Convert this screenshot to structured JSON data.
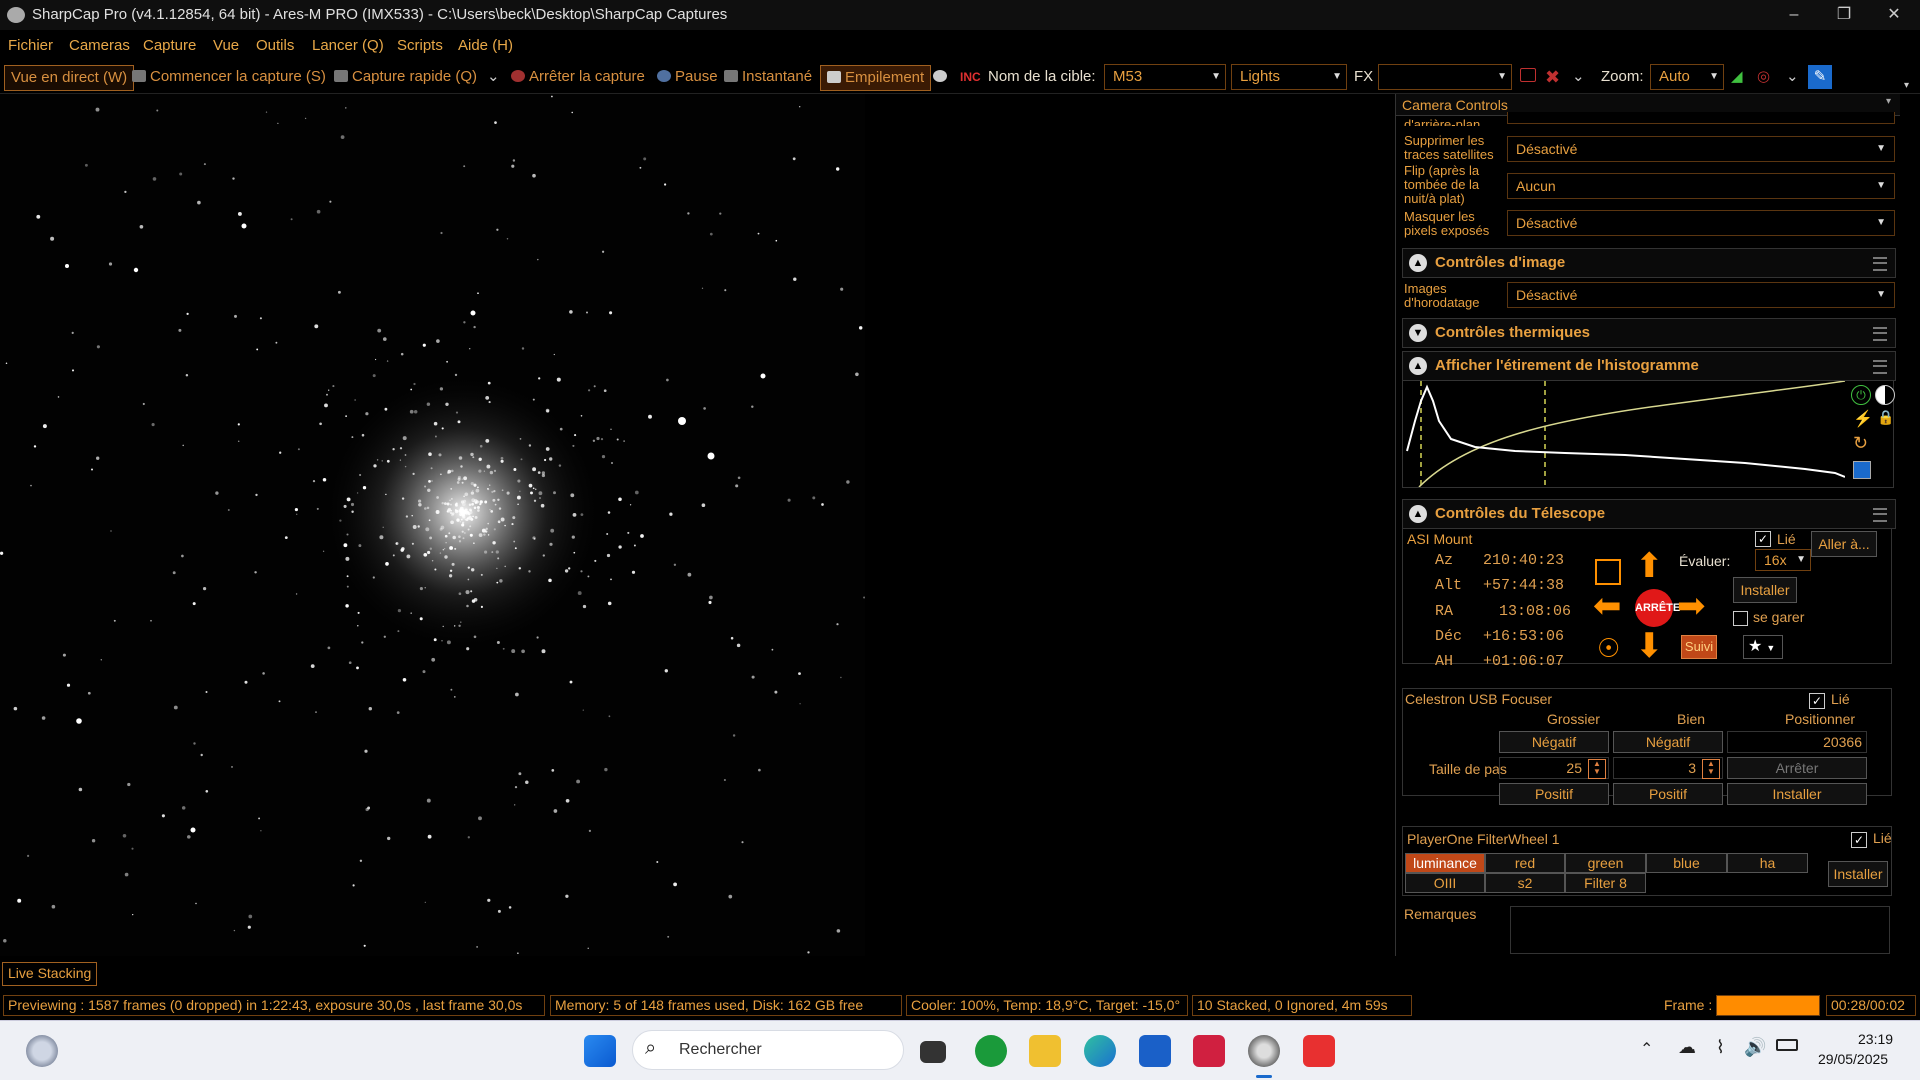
{
  "titlebar": {
    "title": "SharpCap Pro (v4.1.12854, 64 bit) - Ares-M PRO (IMX533) - C:\\Users\\beck\\Desktop\\SharpCap Captures"
  },
  "menu": [
    "Fichier",
    "Cameras",
    "Capture",
    "Vue",
    "Outils",
    "Lancer (Q)",
    "Scripts",
    "Aide (H)"
  ],
  "toolbar": {
    "live": "Vue en direct (W)",
    "start": "Commencer la capture (S)",
    "quick": "Capture rapide (Q)",
    "stop": "Arrêter la capture",
    "pause": "Pause",
    "snapshot": "Instantané",
    "stacking": "Empilement",
    "target_label": "Nom de la cible:",
    "target_value": "M53",
    "frame_type": "Lights",
    "fx_label": "FX",
    "zoom_label": "Zoom:",
    "zoom_value": "Auto"
  },
  "panel": {
    "title": "Camera Controls",
    "partial_label": "d'arrière-plan",
    "rows": [
      {
        "label": "Supprimer les traces satellites",
        "value": "Désactivé"
      },
      {
        "label": "Flip (après la tombée de la nuit/à plat)",
        "value": "Aucun"
      },
      {
        "label": "Masquer les pixels exposés",
        "value": "Désactivé"
      }
    ],
    "image_controls": {
      "header": "Contrôles d'image",
      "row": {
        "label": "Images d'horodatage",
        "value": "Désactivé"
      }
    },
    "thermal_header": "Contrôles thermiques",
    "histogram_header": "Afficher l'étirement de l'histogramme",
    "telescope": {
      "header": "Contrôles du Télescope",
      "mount_name": "ASI Mount",
      "linked": "Lié",
      "goto": "Aller à...",
      "coords": [
        {
          "k": "Az",
          "v": "210:40:23"
        },
        {
          "k": "Alt",
          "v": "+57:44:38"
        },
        {
          "k": "RA",
          "v": "13:08:06"
        },
        {
          "k": "Déc",
          "v": "+16:53:06"
        },
        {
          "k": "AH",
          "v": "+01:06:07"
        }
      ],
      "rate_label": "Évaluer:",
      "rate_value": "16x",
      "stop": "ARRÊTE",
      "setup": "Installer",
      "park": "se garer",
      "tracking": "Suivi"
    },
    "focuser": {
      "name": "Celestron USB Focuser",
      "linked": "Lié",
      "col_coarse": "Grossier",
      "col_fine": "Bien",
      "col_position": "Positionner",
      "neg": "Négatif",
      "pos": "Positif",
      "position_value": "20366",
      "step_label": "Taille de pas",
      "coarse_step": "25",
      "fine_step": "3",
      "stop": "Arrêter",
      "setup": "Installer"
    },
    "filterwheel": {
      "name": "PlayerOne FilterWheel 1",
      "linked": "Lié",
      "filters": [
        "luminance",
        "red",
        "green",
        "blue",
        "ha",
        "OIII",
        "s2",
        "Filter 8"
      ],
      "active": "luminance",
      "setup": "Installer"
    },
    "notes_label": "Remarques"
  },
  "live_stacking": "Live Stacking",
  "status": {
    "preview": "Previewing : 1587 frames (0 dropped) in 1:22:43, exposure 30,0s , last frame 30,0s",
    "memory": "Memory: 5 of 148 frames used, Disk: 162 GB free",
    "cooler": "Cooler: 100%, Temp: 18,9°C, Target: -15,0°",
    "stacked": "10 Stacked, 0 Ignored, 4m 59s",
    "frame_label": "Frame :",
    "frame_time": "00:28/00:02",
    "frame_progress": 1.0
  },
  "taskbar": {
    "search": "Rechercher",
    "time": "23:19",
    "date": "29/05/2025"
  },
  "colors": {
    "accent": "#e8a040",
    "active_fill": "#c04818",
    "progress": "#ff8c00"
  }
}
